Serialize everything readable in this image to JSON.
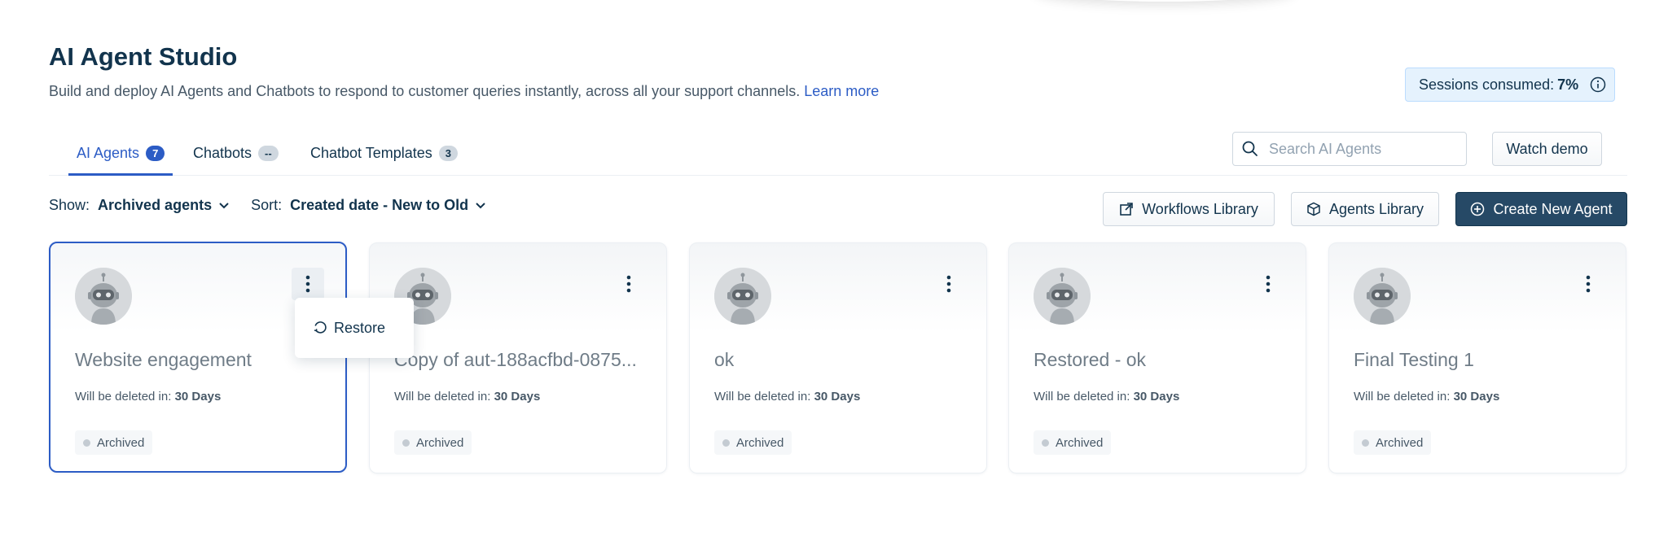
{
  "header": {
    "title": "AI Agent Studio",
    "subtitle": "Build and deploy AI Agents and Chatbots to respond to customer queries instantly, across all your support channels.",
    "learn_more": "Learn more"
  },
  "sessions": {
    "label": "Sessions consumed:",
    "value": "7%"
  },
  "tabs": [
    {
      "label": "AI Agents",
      "count": "7",
      "active": true
    },
    {
      "label": "Chatbots",
      "count": "--"
    },
    {
      "label": "Chatbot Templates",
      "count": "3"
    }
  ],
  "search": {
    "placeholder": "Search AI Agents"
  },
  "actions": {
    "watch_demo": "Watch demo",
    "workflows_library": "Workflows Library",
    "agents_library": "Agents Library",
    "create_new_agent": "Create New Agent"
  },
  "filters": {
    "show_label": "Show:",
    "show_value": "Archived agents",
    "sort_label": "Sort:",
    "sort_value": "Created date - New to Old"
  },
  "cards": [
    {
      "name": "Website engagement",
      "delete_label": "Will be deleted in:",
      "delete_value": "30 Days",
      "status": "Archived"
    },
    {
      "name": "Copy of aut-188acfbd-0875...",
      "delete_label": "Will be deleted in:",
      "delete_value": "30 Days",
      "status": "Archived"
    },
    {
      "name": "ok",
      "delete_label": "Will be deleted in:",
      "delete_value": "30 Days",
      "status": "Archived"
    },
    {
      "name": "Restored - ok",
      "delete_label": "Will be deleted in:",
      "delete_value": "30 Days",
      "status": "Archived"
    },
    {
      "name": "Final Testing 1",
      "delete_label": "Will be deleted in:",
      "delete_value": "30 Days",
      "status": "Archived"
    }
  ],
  "context_menu": {
    "restore": "Restore"
  },
  "colors": {
    "accent": "#2c5cc5",
    "primary_button": "#264966",
    "text": "#12344d"
  }
}
